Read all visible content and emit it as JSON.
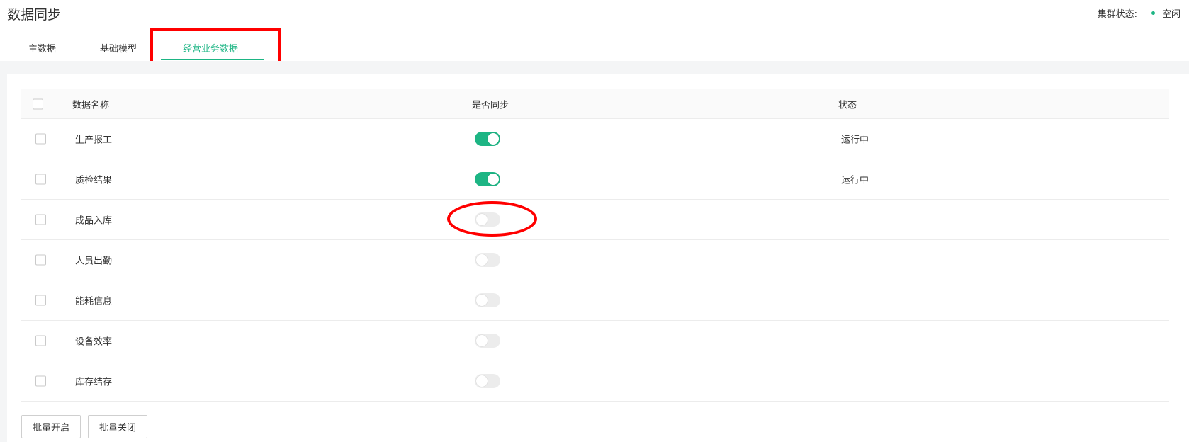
{
  "page": {
    "title": "数据同步"
  },
  "cluster": {
    "label": "集群状态:",
    "value": "空闲",
    "status_color": "#1db584"
  },
  "tabs": [
    {
      "label": "主数据",
      "active": false
    },
    {
      "label": "基础模型",
      "active": false
    },
    {
      "label": "经营业务数据",
      "active": true
    }
  ],
  "table": {
    "headers": {
      "name": "数据名称",
      "sync": "是否同步",
      "status": "状态"
    },
    "rows": [
      {
        "name": "生产报工",
        "sync": true,
        "status": "运行中"
      },
      {
        "name": "质检结果",
        "sync": true,
        "status": "运行中"
      },
      {
        "name": "成品入库",
        "sync": false,
        "status": ""
      },
      {
        "name": "人员出勤",
        "sync": false,
        "status": ""
      },
      {
        "name": "能耗信息",
        "sync": false,
        "status": ""
      },
      {
        "name": "设备效率",
        "sync": false,
        "status": ""
      },
      {
        "name": "库存结存",
        "sync": false,
        "status": ""
      }
    ]
  },
  "actions": {
    "batch_on": "批量开启",
    "batch_off": "批量关闭"
  },
  "colors": {
    "accent": "#1db584",
    "annotation": "#ff0000"
  }
}
